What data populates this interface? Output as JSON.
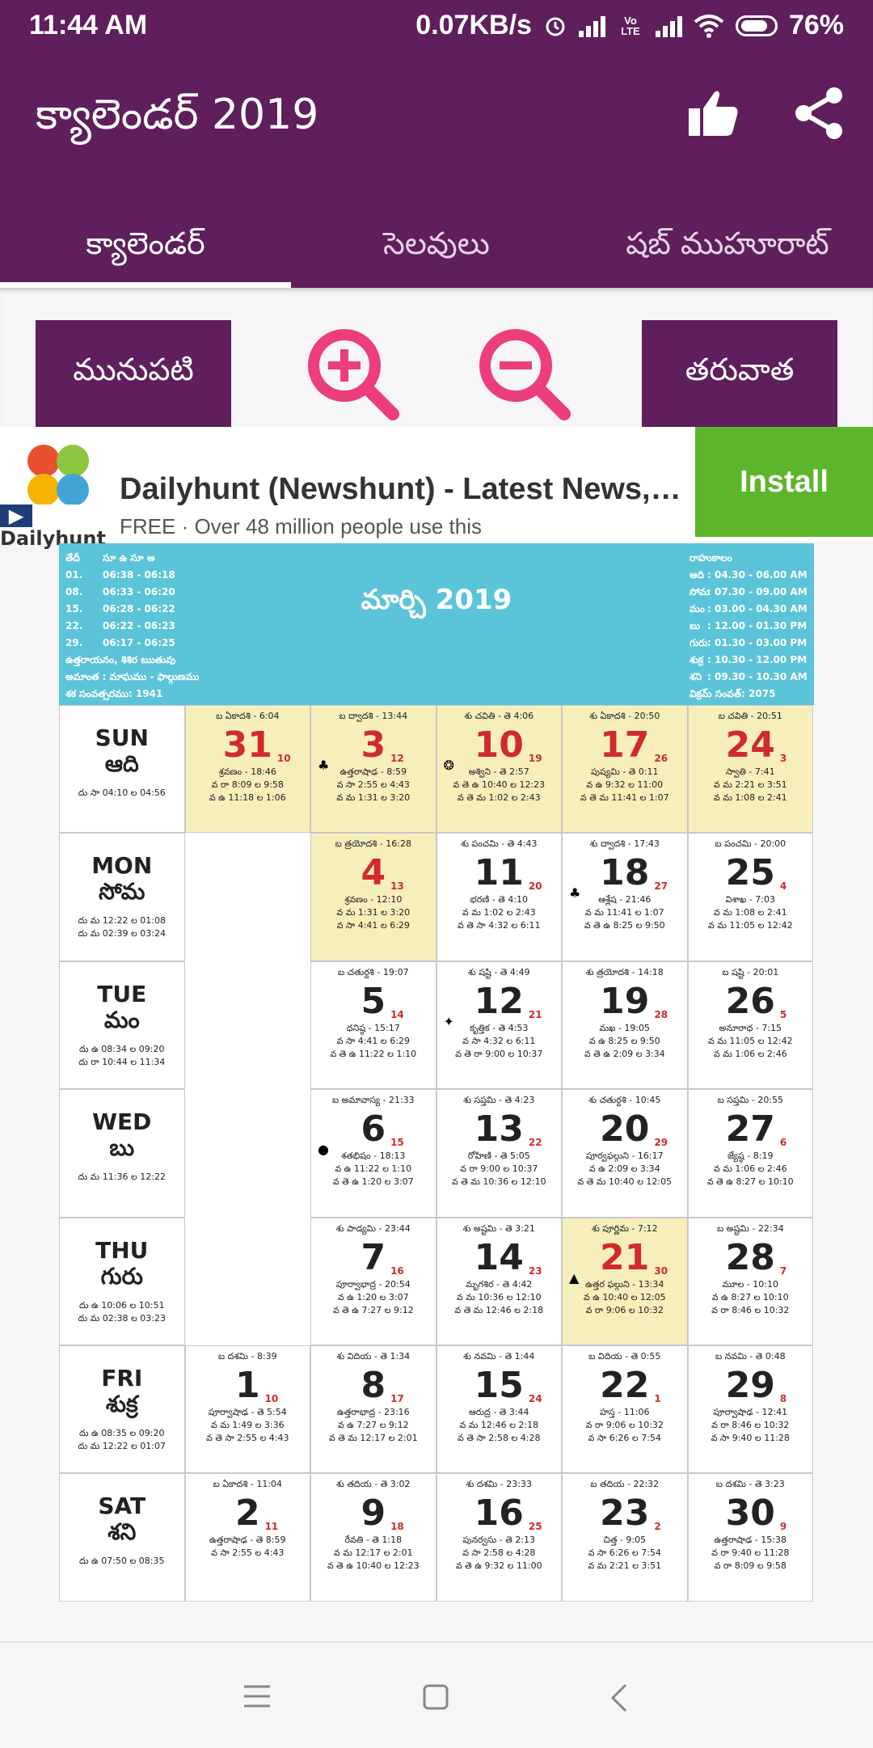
{
  "status": {
    "time": "11:44 AM",
    "speed": "0.07KB/s",
    "battery": "76%",
    "volte": "Vo LTE"
  },
  "app": {
    "title": "క్యాలెండర్ 2019",
    "like_icon": "thumbs-up-icon",
    "share_icon": "share-icon"
  },
  "tabs": [
    "క్యాలెండర్",
    "సెలవులు",
    "షబ్ ముహూరాట్"
  ],
  "controls": {
    "prev": "మునుపటి",
    "next": "తరువాత",
    "zoom_in_icon": "zoom-in-icon",
    "zoom_out_icon": "zoom-out-icon"
  },
  "ad": {
    "brand": "Dailyhunt",
    "title": "Dailyhunt (Newshunt) - Latest News, V...",
    "sub": "FREE · Over 48 million people use this",
    "install": "Install"
  },
  "calendar": {
    "month": "మార్చి 2019",
    "head_left": [
      [
        "తేదీ",
        "సూ ఉ సూ అ"
      ],
      [
        "01.",
        "06:38 - 06:18"
      ],
      [
        "08.",
        "06:33 - 06:20"
      ],
      [
        "15.",
        "06:28 - 06:22"
      ],
      [
        "22.",
        "06:22 - 06:23"
      ],
      [
        "29.",
        "06:17 - 06:25"
      ]
    ],
    "head_left_extra": [
      "ఉత్తరాయనం, శిశిర ఋతువు",
      "అమాంత : మాఘము - ఫాల్గుణము",
      "శక సంవత్సరము: 1941"
    ],
    "head_right": [
      [
        "రాహుకాలం",
        ""
      ],
      [
        "ఆది",
        ": 04.30 - 06.00 AM"
      ],
      [
        "సోమ",
        ": 07.30 - 09.00 AM"
      ],
      [
        "మం",
        ": 03.00 - 04.30 AM"
      ],
      [
        "బు",
        ": 12.00 - 01.30 PM"
      ],
      [
        "గురు",
        ": 01.30 - 03.00 PM"
      ],
      [
        "శుక్ర",
        ": 10.30 - 12.00 PM"
      ],
      [
        "శని",
        ": 09.30 - 10.30 AM"
      ]
    ],
    "head_right_extra": "విక్రమ్ సంవత్: 2075",
    "days": [
      {
        "en": "SUN",
        "te": "ఆది",
        "times": [
          "దు సా 04:10 ల 04:56"
        ]
      },
      {
        "en": "MON",
        "te": "సోమ",
        "times": [
          "దు మ 12:22 ల 01:08",
          "దు మ 02:39 ల 03:24"
        ]
      },
      {
        "en": "TUE",
        "te": "మం",
        "times": [
          "దు ఉ 08:34 ల 09:20",
          "దు రా 10:44 ల 11:34"
        ]
      },
      {
        "en": "WED",
        "te": "బు",
        "times": [
          "దు మ 11:36 ల 12:22"
        ]
      },
      {
        "en": "THU",
        "te": "గురు",
        "times": [
          "దు ఉ 10:06 ల 10:51",
          "దు మ 02:38 ల 03:23"
        ]
      },
      {
        "en": "FRI",
        "te": "శుక్ర",
        "times": [
          "దు ఉ 08:35 ల 09:20",
          "దు మ 12:22 ల 01:07"
        ]
      },
      {
        "en": "SAT",
        "te": "శని",
        "times": [
          "దు ఉ 07:50 ల 08:35"
        ]
      }
    ],
    "weeks": [
      [
        {
          "d": "31",
          "t": "10",
          "top": "బ ఏకాదశి - 6:04",
          "lines": [
            "శ్రవణం - 18:46",
            "వ రా 8:09 ల 9:58",
            "వ ఉ 11:18 ల 1:06"
          ],
          "hl": true,
          "red": true
        },
        {
          "d": "3",
          "t": "12",
          "top": "బ ద్వాదశి - 13:44",
          "lines": [
            "ఉత్తరాషాఢ - 8:59",
            "వ సా 2:55 ల 4:43",
            "వ మ 1:31 ల 3:20"
          ],
          "hl": true,
          "red": true,
          "mark": "♣"
        },
        {
          "d": "10",
          "t": "19",
          "top": "శు చవితి - తె 4:06",
          "lines": [
            "అశ్విని - తె 2:57",
            "వ తె ఉ 10:40 ల 12:23",
            "వ తె మ 1:02 ల 2:43"
          ],
          "hl": true,
          "red": true,
          "mark": "❂"
        },
        {
          "d": "17",
          "t": "26",
          "top": "శు ఏకాదశి - 20:50",
          "lines": [
            "పుష్యమి - తె 0:11",
            "వ ఉ 9:32 ల 11:00",
            "వ తె మ 11:41 ల 1:07"
          ],
          "hl": true,
          "red": true
        },
        {
          "d": "24",
          "t": "3",
          "top": "బ చవితి - 20:51",
          "lines": [
            "స్వాతి - 7:41",
            "వ మ 2:21 ల 3:51",
            "వ మ 1:08 ల 2:41"
          ],
          "hl": true,
          "red": true
        }
      ],
      [
        null,
        {
          "d": "4",
          "t": "13",
          "top": "బ త్రయోదశి - 16:28",
          "lines": [
            "శ్రవణం - 12:10",
            "వ మ 1:31 ల 3:20",
            "వ సా 4:41 ల 6:29"
          ],
          "hl": true,
          "red": true
        },
        {
          "d": "11",
          "t": "20",
          "top": "శు పంచమి - తె 4:43",
          "lines": [
            "భరణి - తె 4:10",
            "వ మ 1:02 ల 2:43",
            "వ తె సా 4:32 ల 6:11"
          ]
        },
        {
          "d": "18",
          "t": "27",
          "top": "శు ద్వాదశి - 17:43",
          "lines": [
            "ఆశ్లేష - 21:46",
            "వ మ 11:41 ల 1:07",
            "వ తె ఉ 8:25 ల 9:50"
          ],
          "mark": "♣"
        },
        {
          "d": "25",
          "t": "4",
          "top": "బ పంచమి - 20:00",
          "lines": [
            "విశాఖ - 7:03",
            "వ మ 1:08 ల 2:41",
            "వ మ 11:05 ల 12:42"
          ]
        }
      ],
      [
        null,
        {
          "d": "5",
          "t": "14",
          "top": "బ చతుర్దశి - 19:07",
          "lines": [
            "ధనిష్ఠ - 15:17",
            "వ సా 4:41 ల 6:29",
            "వ తె ఉ 11:22 ల 1:10"
          ]
        },
        {
          "d": "12",
          "t": "21",
          "top": "శు షష్టి - తె 4:49",
          "lines": [
            "కృత్తిక - తె 4:53",
            "వ సా 4:32 ల 6:11",
            "వ తె రా 9:00 ల 10:37"
          ],
          "mark": "✦"
        },
        {
          "d": "19",
          "t": "28",
          "top": "శు త్రయోదశి - 14:18",
          "lines": [
            "మఖ - 19:05",
            "వ ఉ 8:25 ల 9:50",
            "వ తె ఉ 2:09 ల 3:34"
          ]
        },
        {
          "d": "26",
          "t": "5",
          "top": "బ షష్టి - 20:01",
          "lines": [
            "అనూరాధ - 7:15",
            "వ మ 11:05 ల 12:42",
            "వ మ 1:06 ల 2:46"
          ]
        }
      ],
      [
        null,
        {
          "d": "6",
          "t": "15",
          "top": "బ అమావాస్య - 21:33",
          "lines": [
            "శతభిషం - 18:13",
            "వ ఉ 11:22 ల 1:10",
            "వ తె ఉ 1:20 ల 3:07"
          ],
          "mark": "●"
        },
        {
          "d": "13",
          "t": "22",
          "top": "శు సప్తమి - తె 4:23",
          "lines": [
            "రోహిణి - తె 5:05",
            "వ రా 9:00 ల 10:37",
            "వ తె మ 10:36 ల 12:10"
          ]
        },
        {
          "d": "20",
          "t": "29",
          "top": "శు చతుర్దశి - 10:45",
          "lines": [
            "పూర్వఫల్గుని - 16:17",
            "వ ఉ 2:09 ల 3:34",
            "వ తె మ 10:40 ల 12:05"
          ]
        },
        {
          "d": "27",
          "t": "6",
          "top": "బ సప్తమి - 20:55",
          "lines": [
            "జ్యేష్ఠ - 8:19",
            "వ మ 1:06 ల 2:46",
            "వ తె ఉ 8:27 ల 10:10"
          ]
        }
      ],
      [
        null,
        {
          "d": "7",
          "t": "16",
          "top": "శు పాడ్యమి - 23:44",
          "lines": [
            "పూర్వాభాద్ర - 20:54",
            "వ ఉ 1:20 ల 3:07",
            "వ తె ఉ 7:27 ల 9:12"
          ]
        },
        {
          "d": "14",
          "t": "23",
          "top": "శు అష్టమి - తె 3:21",
          "lines": [
            "మృగశిర - తె 4:42",
            "వ మ 10:36 ల 12:10",
            "వ తె మ 12:46 ల 2:18"
          ]
        },
        {
          "d": "21",
          "t": "30",
          "top": "శు పూర్ణిమ - 7:12",
          "lines": [
            "ఉత్తర ఫల్గుని - 13:34",
            "వ ఉ 10:40 ల 12:05",
            "వ రా 9:06 ల 10:32"
          ],
          "hl": true,
          "red": true,
          "mark": "▲"
        },
        {
          "d": "28",
          "t": "7",
          "top": "బ అష్టమి - 22:34",
          "lines": [
            "మూల - 10:10",
            "వ ఉ 8:27 ల 10:10",
            "వ రా 8:46 ల 10:32"
          ]
        }
      ],
      [
        {
          "d": "1",
          "t": "10",
          "top": "బ దశమి - 8:39",
          "lines": [
            "పూర్వాషాఢ - తె 5:54",
            "వ మ 1:49 ల 3:36",
            "వ తె సా 2:55 ల 4:43"
          ]
        },
        {
          "d": "8",
          "t": "17",
          "top": "శు విదియ - తె 1:34",
          "lines": [
            "ఉత్తరాభాద్ర - 23:16",
            "వ ఉ 7:27 ల 9:12",
            "వ తె మ 12:17 ల 2:01"
          ]
        },
        {
          "d": "15",
          "t": "24",
          "top": "శు నవమి - తె 1:44",
          "lines": [
            "ఆరుద్ర - తె 3:44",
            "వ మ 12:46 ల 2:18",
            "వ తె సా 2:58 ల 4:28"
          ]
        },
        {
          "d": "22",
          "t": "1",
          "top": "బ విదియ - తె 0:55",
          "lines": [
            "హస్త - 11:06",
            "వ రా 9:06 ల 10:32",
            "వ సా 6:26 ల 7:54"
          ]
        },
        {
          "d": "29",
          "t": "8",
          "top": "బ నవమి - తె 0:48",
          "lines": [
            "పూర్వాషాఢ - 12:41",
            "వ రా 8:46 ల 10:32",
            "వ సా 9:40 ల 11:28"
          ]
        }
      ],
      [
        {
          "d": "2",
          "t": "11",
          "top": "బ ఏకాదశి - 11:04",
          "lines": [
            "ఉత్తరాషాఢ - తె 8:59",
            "వ సా 2:55 ల 4:43"
          ]
        },
        {
          "d": "9",
          "t": "18",
          "top": "శు తదియ - తె 3:02",
          "lines": [
            "రేవతి - తె 1:18",
            "వ మ 12:17 ల 2:01",
            "వ తె ఉ 10:40 ల 12:23"
          ]
        },
        {
          "d": "16",
          "t": "25",
          "top": "శు దశమి - 23:33",
          "lines": [
            "పునర్వసు - తె 2:13",
            "వ సా 2:58 ల 4:28",
            "వ తె ఉ 9:32 ల 11:00"
          ]
        },
        {
          "d": "23",
          "t": "2",
          "top": "బ తదియ - 22:32",
          "lines": [
            "చిత్త - 9:05",
            "వ సా 6:26 ల 7:54",
            "వ మ 2:21 ల 3:51"
          ]
        },
        {
          "d": "30",
          "t": "9",
          "top": "బ దశమి - తె 3:23",
          "lines": [
            "ఉత్తరాషాఢ - 15:38",
            "వ రా 9:40 ల 11:28",
            "వ రా 8:09 ల 9:58"
          ]
        }
      ]
    ]
  },
  "navbar": {
    "menu_icon": "menu-icon",
    "home_icon": "home-square-icon",
    "back_icon": "back-chevron-icon"
  }
}
